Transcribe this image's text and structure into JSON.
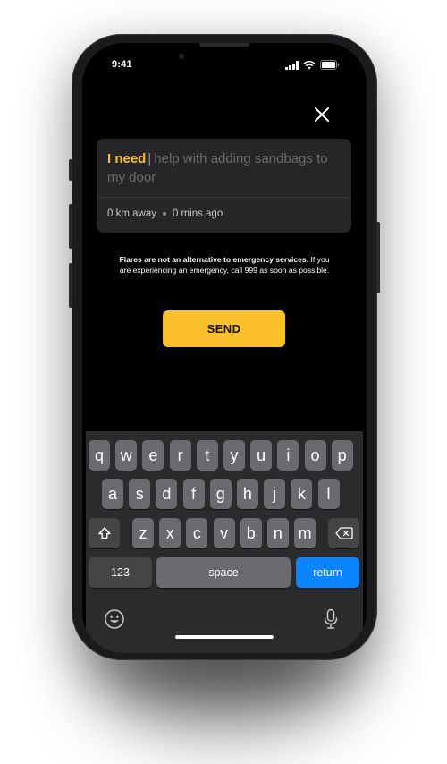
{
  "status_bar": {
    "time": "9:41"
  },
  "flare_card": {
    "prefix": "I need",
    "cursor": "|",
    "body": "help with adding sandbags to my door",
    "distance": "0 km away",
    "elapsed": "0 mins ago"
  },
  "disclaimer": {
    "bold": "Flares are not an alternative to emergency services.",
    "rest": " If you are experiencing an emergency, call 999 as soon as possible."
  },
  "send_label": "SEND",
  "keyboard": {
    "row1": [
      "q",
      "w",
      "e",
      "r",
      "t",
      "y",
      "u",
      "i",
      "o",
      "p"
    ],
    "row2": [
      "a",
      "s",
      "d",
      "f",
      "g",
      "h",
      "j",
      "k",
      "l"
    ],
    "row3": [
      "z",
      "x",
      "c",
      "v",
      "b",
      "n",
      "m"
    ],
    "numbers_label": "123",
    "space_label": "space",
    "return_label": "return"
  },
  "colors": {
    "accent": "#fbc12d",
    "return_key": "#0a84ff",
    "card": "#262628",
    "screen": "#000000"
  }
}
